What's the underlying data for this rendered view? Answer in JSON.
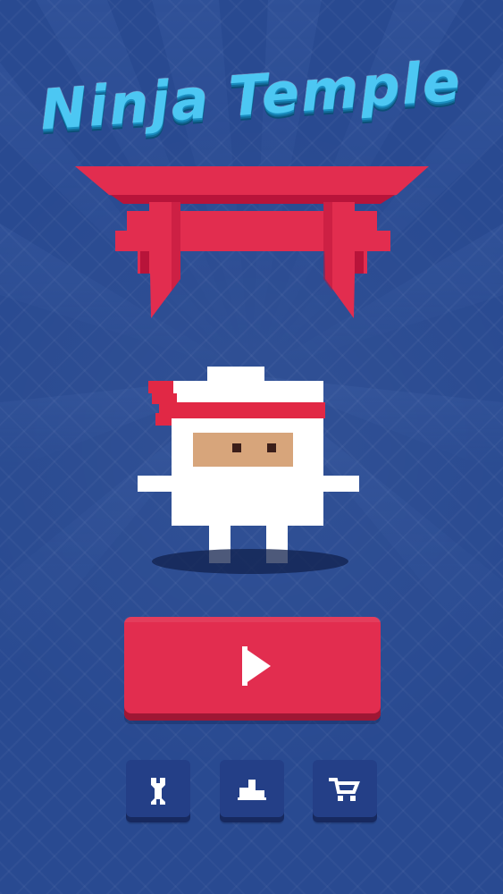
{
  "game": {
    "title_words": [
      "Ninja",
      "Temple"
    ]
  },
  "colors": {
    "background": "#294a91",
    "title_primary": "#4cc7f3",
    "title_shadow": "#126d9b",
    "gate_red": "#e22d4f",
    "gate_dark": "#b8143a",
    "ninja_white": "#ffffff",
    "ninja_headband": "#e12845",
    "ninja_skin": "#d7a57b",
    "button_primary": "#e22d4f",
    "button_secondary": "#243f87"
  },
  "menu": {
    "primary_action": {
      "icon": "play-icon"
    },
    "secondary_actions": [
      {
        "icon": "wrench-icon"
      },
      {
        "icon": "podium-icon"
      },
      {
        "icon": "cart-icon"
      }
    ]
  },
  "scene": {
    "gate_icon": "torii-gate-icon",
    "character_icon": "ninja-icon"
  }
}
